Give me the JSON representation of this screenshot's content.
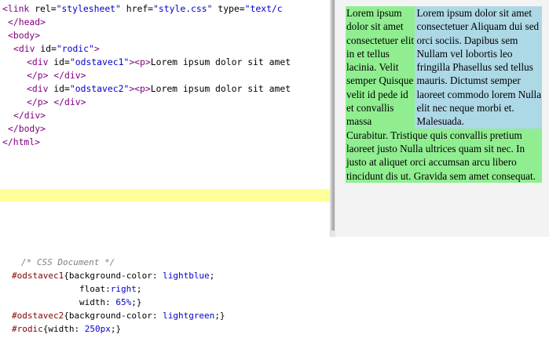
{
  "html_editor": {
    "lines": [
      {
        "parts": [
          [
            "tag",
            "<link "
          ],
          [
            "attr",
            "rel="
          ],
          [
            "str",
            "\"stylesheet\""
          ],
          [
            "attr",
            " href="
          ],
          [
            "str",
            "\"style.css\""
          ],
          [
            "attr",
            " type="
          ],
          [
            "str",
            "\"text/c"
          ]
        ]
      },
      {
        "parts": [
          [
            "tag",
            "</head>"
          ]
        ]
      },
      {
        "parts": [
          [
            "tag",
            "<body>"
          ]
        ]
      },
      {
        "parts": [
          [
            "tag",
            "<div "
          ],
          [
            "attr",
            "id="
          ],
          [
            "str",
            "\"rodic\""
          ],
          [
            "tag",
            ">"
          ]
        ]
      },
      {
        "parts": [
          [
            "tag",
            "<div "
          ],
          [
            "attr",
            "id="
          ],
          [
            "str",
            "\"odstavec1\""
          ],
          [
            "tag",
            ">"
          ],
          [
            "tag",
            "<p>"
          ],
          [
            "txt",
            "Lorem ipsum dolor sit amet"
          ]
        ]
      },
      {
        "parts": [
          [
            "tag",
            "</p>"
          ],
          [
            "txt",
            " "
          ],
          [
            "tag",
            "</div>"
          ]
        ]
      },
      {
        "parts": [
          [
            "tag",
            "<div "
          ],
          [
            "attr",
            "id="
          ],
          [
            "str",
            "\"odstavec2\""
          ],
          [
            "tag",
            ">"
          ],
          [
            "tag",
            "<p>"
          ],
          [
            "txt",
            "Lorem ipsum dolor sit amet"
          ]
        ]
      },
      {
        "parts": [
          [
            "tag",
            "</p>"
          ],
          [
            "txt",
            " "
          ],
          [
            "tag",
            "</div>"
          ]
        ]
      },
      {
        "parts": [
          [
            "tag",
            "</div>"
          ]
        ]
      },
      {
        "parts": [
          [
            "tag",
            "</body>"
          ]
        ]
      },
      {
        "parts": [
          [
            "tag",
            "</html>"
          ]
        ]
      }
    ]
  },
  "preview": {
    "odstavec1_text": "Lorem ipsum dolor sit amet consectetuer Aliquam dui sed orci sociis. Dapibus sem Nullam vel lobortis leo fringilla Phasellus sed tellus mauris. Dictumst semper laoreet commodo lorem Nulla elit nec neque morbi et. Malesuada.",
    "odstavec2_text": "Lorem ipsum dolor sit amet consectetuer elit in et tellus lacinia. Velit semper Quisque velit id pede id et convallis massa Curabitur. Tristique quis convallis pretium laoreet justo Nulla ultrices quam sit nec. In justo at aliquet orci accumsan arcu libero tincidunt dis ut. Gravida sem amet consequat.",
    "colors": {
      "odstavec1": "#add8e6",
      "odstavec2": "#90ee90",
      "background": "#f3f3f3"
    }
  },
  "css_code": {
    "lines": [
      {
        "parts": [
          [
            "comment",
            "/* CSS Document */"
          ]
        ]
      },
      {
        "parts": [
          [
            "sel",
            "#odstavec1"
          ],
          [
            "prop",
            "{background-color: "
          ],
          [
            "val",
            "lightblue"
          ],
          [
            "prop",
            ";"
          ]
        ]
      },
      {
        "parts": [
          [
            "prop",
            "float:"
          ],
          [
            "val",
            "right"
          ],
          [
            "prop",
            ";"
          ]
        ]
      },
      {
        "parts": [
          [
            "prop",
            "width: "
          ],
          [
            "val",
            "65%"
          ],
          [
            "prop",
            ";}"
          ]
        ]
      },
      {
        "parts": [
          [
            "sel",
            "#odstavec2"
          ],
          [
            "prop",
            "{background-color: "
          ],
          [
            "val",
            "lightgreen"
          ],
          [
            "prop",
            ";}"
          ]
        ]
      },
      {
        "parts": [
          [
            "sel",
            "#rodic"
          ],
          [
            "prop",
            "{width: "
          ],
          [
            "val",
            "250px"
          ],
          [
            "prop",
            ";}"
          ]
        ]
      }
    ]
  }
}
